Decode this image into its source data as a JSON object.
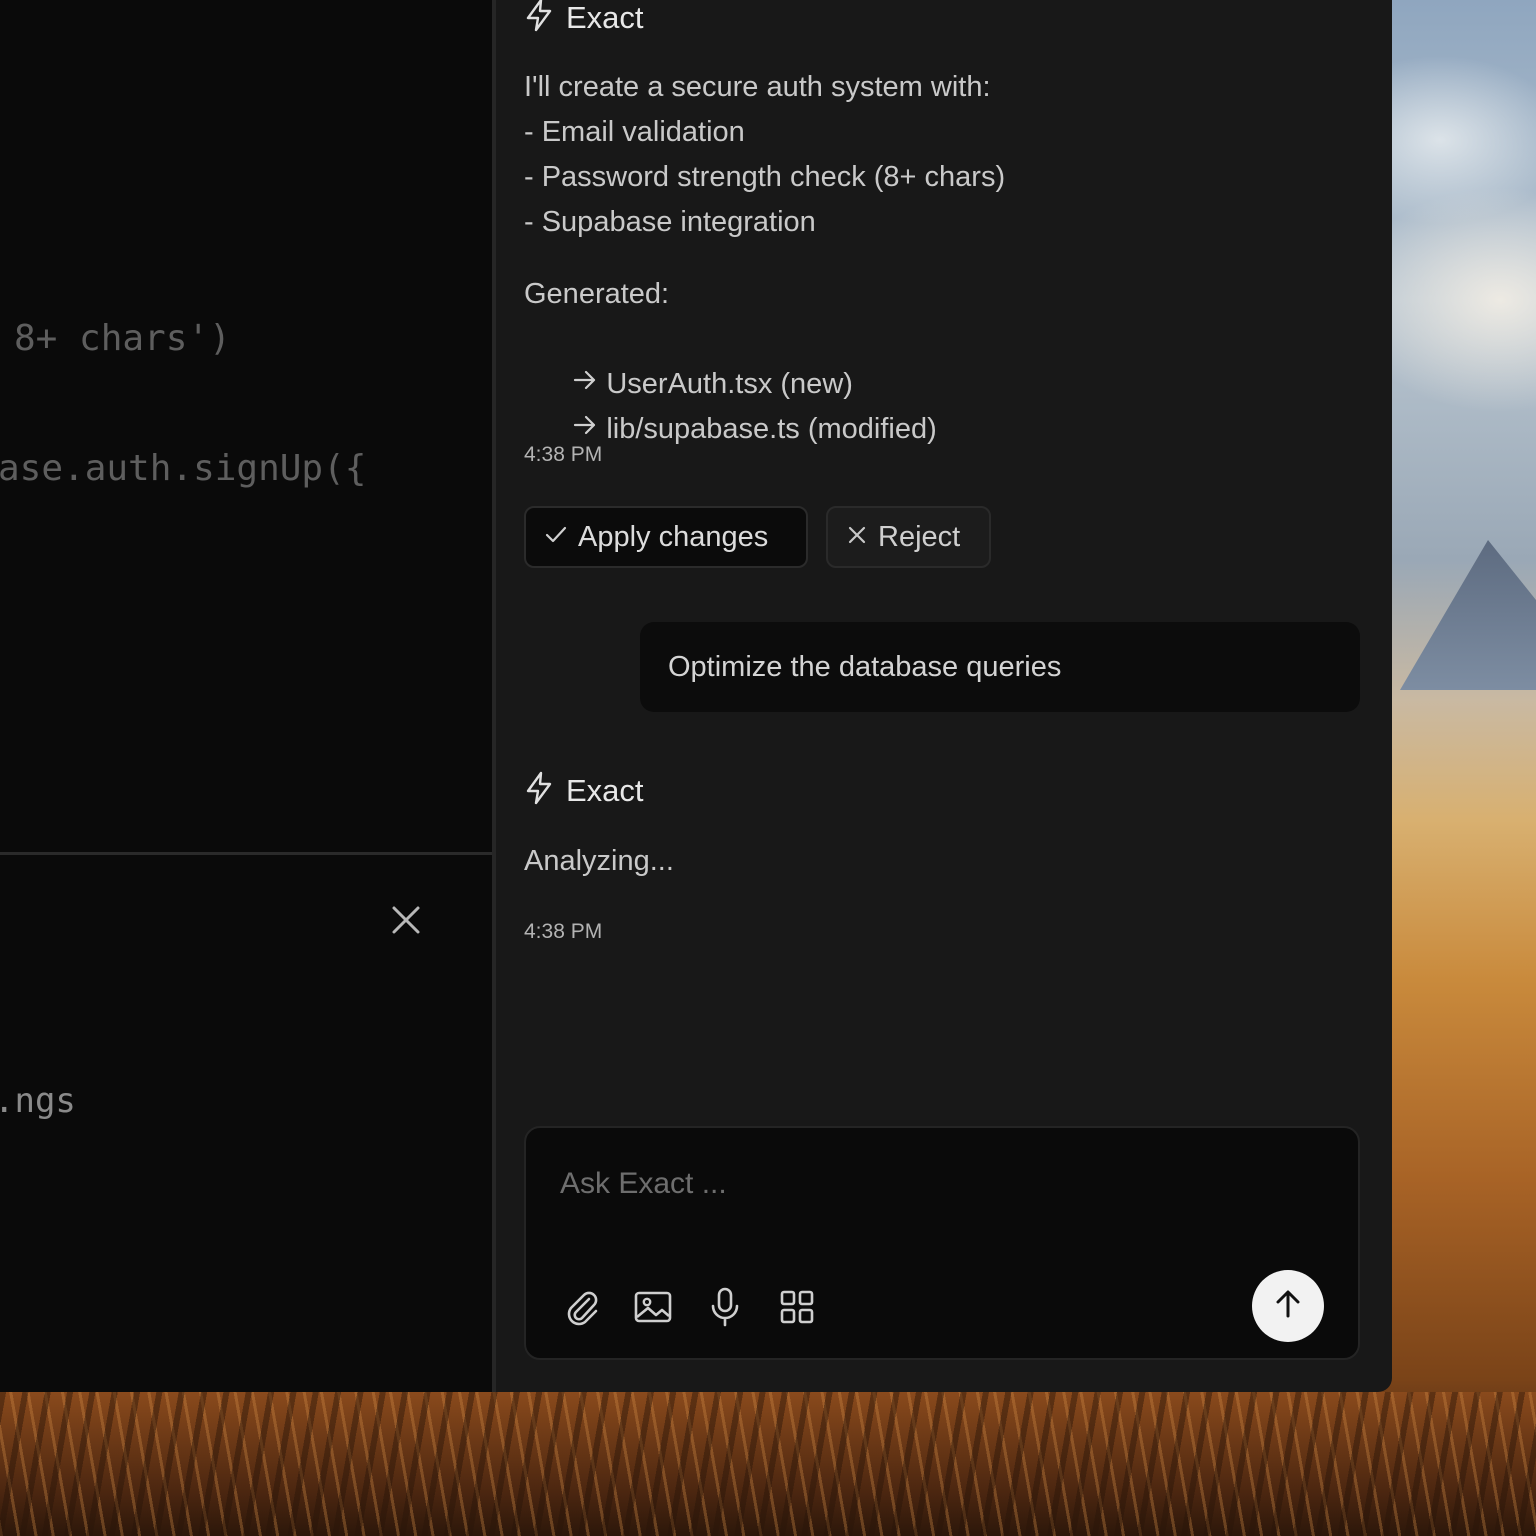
{
  "editor": {
    "code_lines": [
      "8+ chars')",
      "ase.auth.signUp({"
    ]
  },
  "terminal": {
    "partial_text": ".ngs",
    "close_icon": "close-icon"
  },
  "chat": {
    "agent_name": "Exact",
    "messages": [
      {
        "role": "agent",
        "author": "Exact",
        "intro_lines": [
          "I'll create a secure auth system with:",
          "- Email validation",
          "- Password strength check (8+ chars)",
          "- Supabase integration"
        ],
        "generated_label": "Generated:",
        "files": [
          "UserAuth.tsx (new)",
          "lib/supabase.ts (modified)"
        ],
        "time": "4:38 PM",
        "actions": {
          "apply_label": "Apply changes",
          "reject_label": "Reject"
        }
      },
      {
        "role": "user",
        "text": "Optimize the database queries"
      },
      {
        "role": "agent",
        "author": "Exact",
        "text": "Analyzing...",
        "time": "4:38 PM"
      }
    ],
    "composer": {
      "placeholder": "Ask Exact ...",
      "tools": [
        "paperclip-icon",
        "image-icon",
        "microphone-icon",
        "grid-icon"
      ],
      "send_icon": "arrow-up-icon"
    }
  },
  "colors": {
    "panel_bg": "#181818",
    "editor_bg": "#0a0a0a",
    "send_button_bg": "#f2f2f2"
  }
}
